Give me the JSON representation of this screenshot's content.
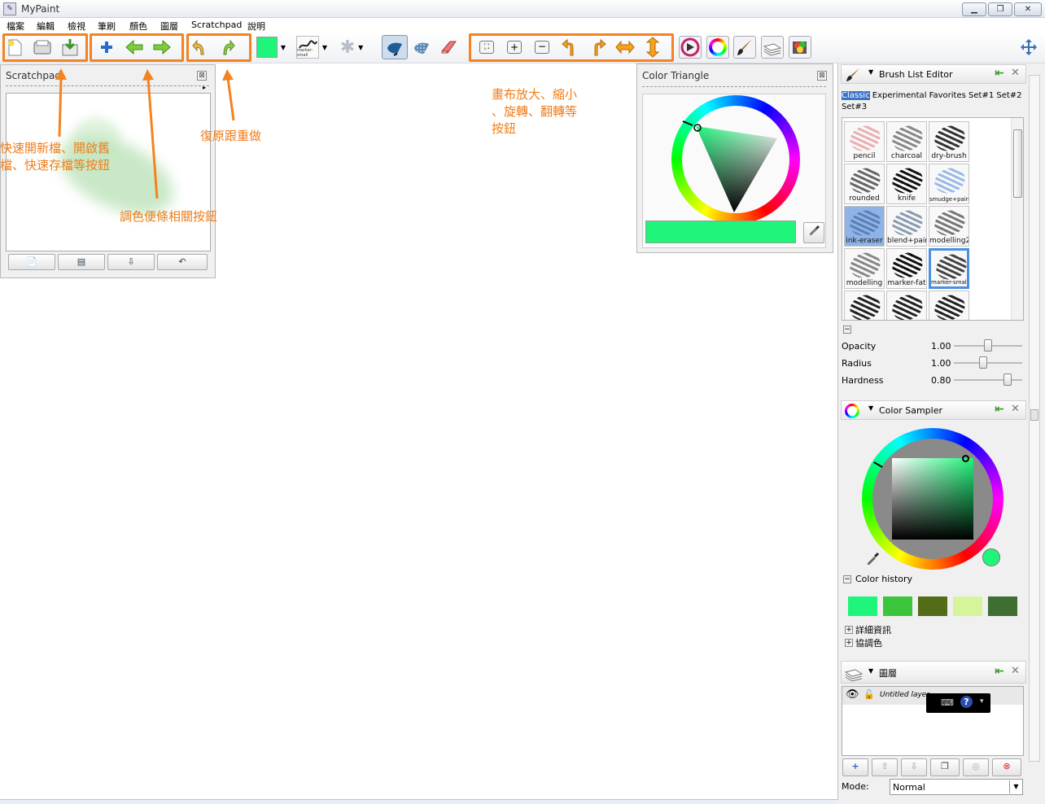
{
  "window": {
    "title": "MyPaint",
    "app_icon": "mypaint-icon",
    "min": "▁",
    "max": "❐",
    "close": "✕"
  },
  "menu": [
    "檔案",
    "編輯",
    "檢視",
    "筆刷",
    "顏色",
    "圖層",
    "Scratchpad",
    "說明"
  ],
  "toolbar": {
    "file_buttons": [
      "new-file-icon",
      "open-file-icon",
      "quick-save-icon"
    ],
    "color_buttons": [
      "add-color-icon",
      "previous-color-icon",
      "next-color-icon"
    ],
    "history_buttons": [
      "undo-icon",
      "redo-icon"
    ],
    "current_color": "#1ef57a",
    "brush_preview_label": "marker-small",
    "mode_buttons": [
      "freehand-icon",
      "blend-mode-icon",
      "eraser-icon"
    ],
    "view_buttons": [
      "fit-view-icon",
      "zoom-in-icon",
      "zoom-out-icon",
      "rotate-left-icon",
      "rotate-right-icon",
      "flip-horizontal-icon",
      "flip-vertical-icon"
    ],
    "panel_buttons": [
      "color-sampler-panel-icon",
      "color-wheel-panel-icon",
      "brush-panel-icon",
      "layers-panel-icon",
      "scratchpad-panel-icon"
    ],
    "fullscreen": "fullscreen-icon"
  },
  "annotations": {
    "file": [
      "快速開新檔、開啟舊",
      "檔、快速存檔等按鈕"
    ],
    "color": "調色便條相關按鈕",
    "history": "復原跟重做",
    "view": [
      "畫布放大、縮小",
      "、旋轉、翻轉等",
      "按鈕"
    ],
    "accent": "#f58220"
  },
  "scratchpad": {
    "title": "Scratchpad",
    "close": "⊠",
    "buttons": [
      "new-scratchpad-icon",
      "open-scratchpad-icon",
      "save-scratchpad-icon",
      "revert-scratchpad-icon"
    ]
  },
  "color_triangle": {
    "title": "Color Triangle",
    "close": "⊠",
    "selected_color": "#1ef57a",
    "picker": "eyedropper-icon"
  },
  "brush_list": {
    "title": "Brush List Editor",
    "groups_line1": [
      "Classic",
      "Experimental",
      "Favorites",
      "Set#1",
      "Set#2"
    ],
    "groups_line2": [
      "Set#3"
    ],
    "active_group": "Classic",
    "brushes": [
      "pencil",
      "charcoal",
      "dry-brush",
      "rounded",
      "knife",
      "smudge+paint",
      "ink-eraser",
      "blend+paint",
      "modelling2",
      "modelling",
      "marker-fat",
      "marker-small",
      "",
      "",
      ""
    ],
    "selected_brush": "marker-small"
  },
  "brush_settings": [
    {
      "label": "Opacity",
      "value": "1.00",
      "level": 0.5
    },
    {
      "label": "Radius",
      "value": "1.00",
      "level": 0.43
    },
    {
      "label": "Hardness",
      "value": "0.80",
      "level": 0.78
    }
  ],
  "color_sampler": {
    "title": "Color Sampler",
    "current": "#1ef57a",
    "history_label": "Color history",
    "history": [
      "#1ef57a",
      "#3cc43a",
      "#546c18",
      "#d6f59a",
      "#3e6e32"
    ],
    "details_label": "詳細資訊",
    "harmony_label": "協調色"
  },
  "layers": {
    "title": "圖層",
    "layer_name": "Untitled layer",
    "buttons": [
      "add-layer-icon",
      "move-layer-up-icon",
      "move-layer-down-icon",
      "duplicate-layer-icon",
      "merge-layer-icon",
      "delete-layer-icon"
    ],
    "mode_label": "Mode:",
    "mode_value": "Normal"
  }
}
